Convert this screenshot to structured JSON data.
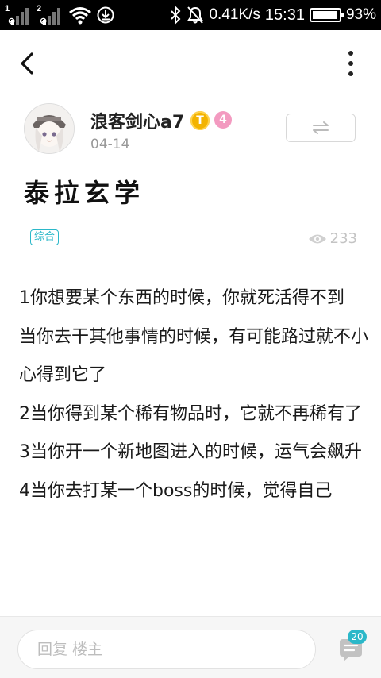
{
  "status_bar": {
    "sim1": "1",
    "sim2": "2",
    "speed": "0.41K/s",
    "time": "15:31",
    "battery": "93%",
    "battery_level": 0.93
  },
  "author": {
    "name": "浪客剑心a7",
    "badge_t": "T",
    "level": "4",
    "date": "04-14"
  },
  "post": {
    "title": "泰拉玄学",
    "category": "综合",
    "views": "233",
    "paragraphs": [
      "1你想要某个东西的时候，你就死活得不到",
      "当你去干其他事情的时候，有可能路过就不小心得到它了",
      "2当你得到某个稀有物品时，它就不再稀有了",
      "3当你开一个新地图进入的时候，运气会飙升",
      "4当你去打某一个boss的时候，觉得自己"
    ]
  },
  "bottom": {
    "reply_placeholder": "回复 楼主",
    "comment_count": "20"
  },
  "colors": {
    "accent": "#2bb8c9",
    "gold_badge": "#f3b300",
    "level_badge": "#f39ac0"
  },
  "icons": [
    "back-arrow-icon",
    "more-icon",
    "switch-icon",
    "eye-icon",
    "comment-icon",
    "wifi-icon",
    "download-icon",
    "bluetooth-icon",
    "mute-icon"
  ]
}
